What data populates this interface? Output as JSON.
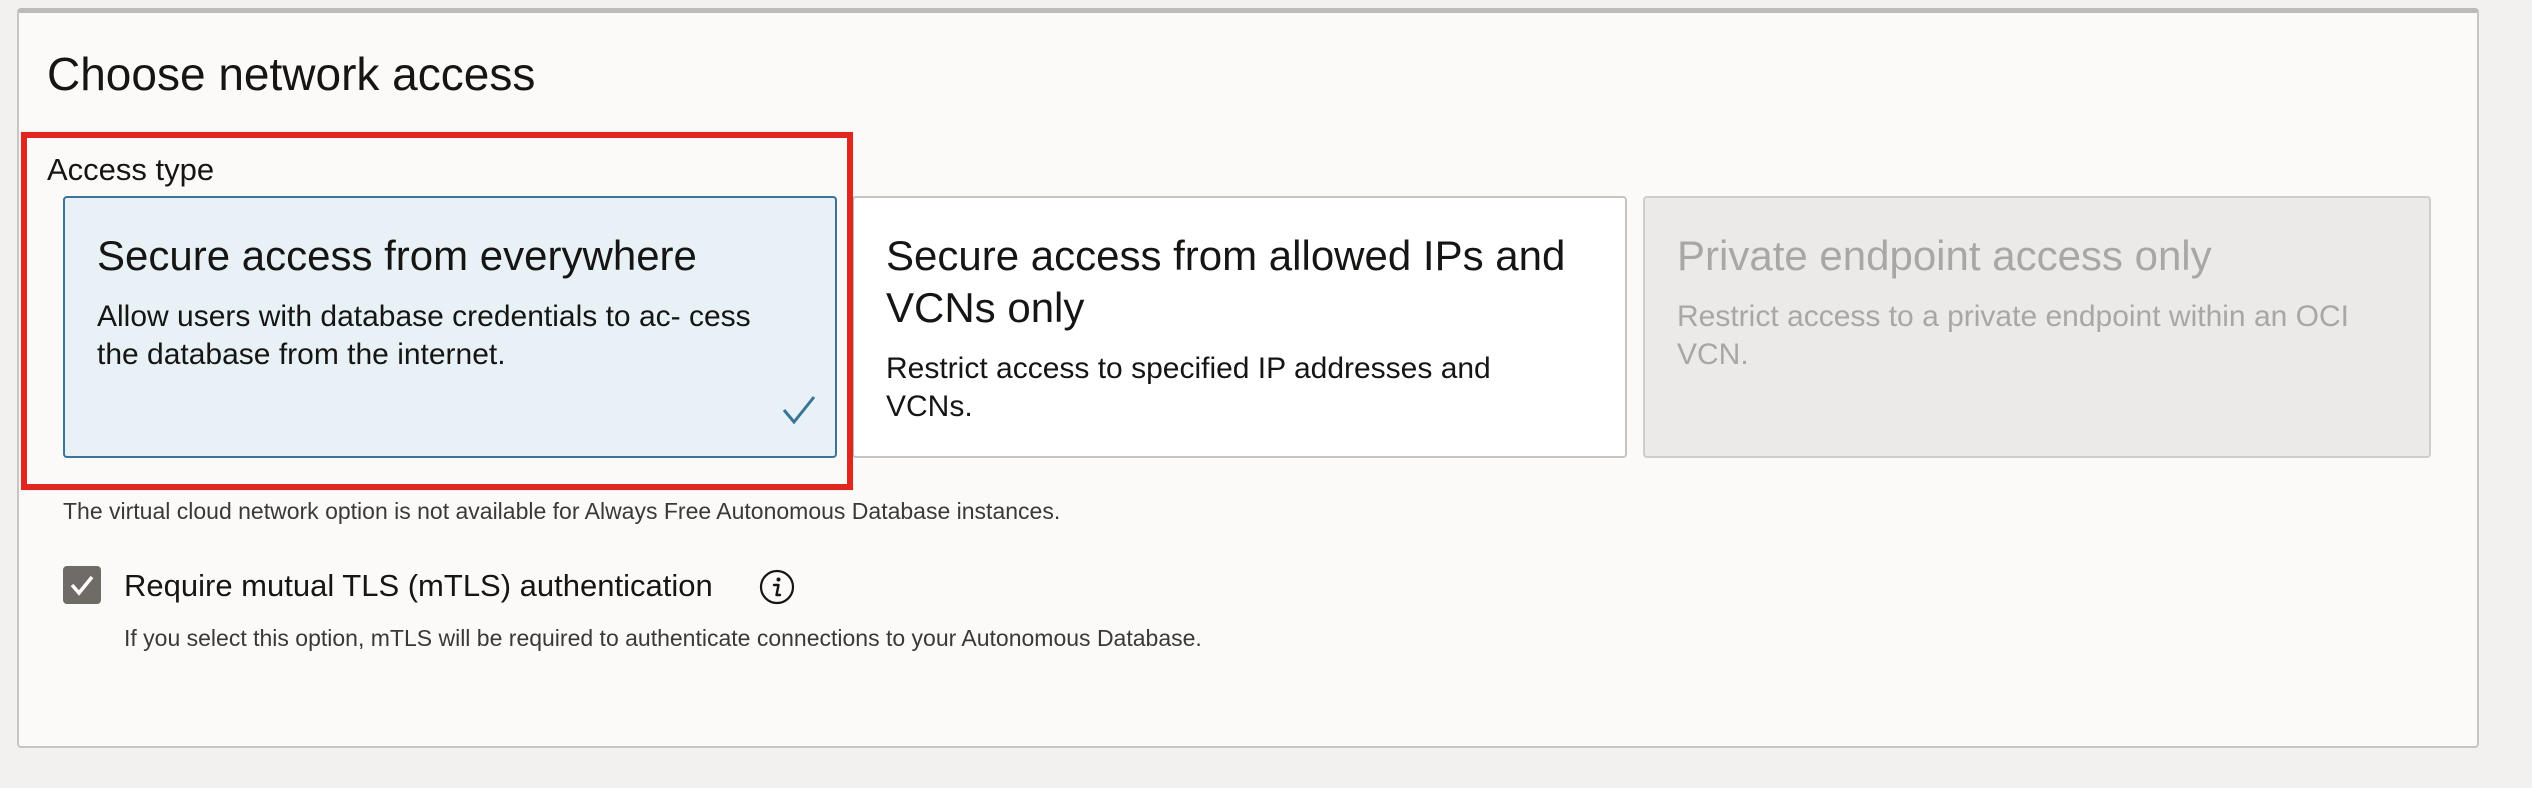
{
  "network_access": {
    "title": "Choose network access",
    "access_type_label": "Access type",
    "options": [
      {
        "title": "Secure access from everywhere",
        "description": "Allow users with database credentials to ac- cess the database from the internet.",
        "selected": true,
        "disabled": false
      },
      {
        "title": "Secure access from allowed IPs and VCNs only",
        "description": "Restrict access to specified IP addresses and VCNs.",
        "selected": false,
        "disabled": false
      },
      {
        "title": "Private endpoint access only",
        "description": "Restrict access to a private endpoint within an OCI VCN.",
        "selected": false,
        "disabled": true
      }
    ],
    "vcn_note": "The virtual cloud network option is not available for Always Free Autonomous Database instances.",
    "mtls": {
      "label": "Require mutual TLS (mTLS) authentication",
      "checked": true,
      "help_text": "If you select this option, mTLS will be required to authenticate connections to your Autonomous Database."
    }
  },
  "icons": {
    "selected_check": "check-icon",
    "checkbox_check": "checkmark-icon",
    "info": "info-icon"
  },
  "colors": {
    "highlight_border": "#e0261e",
    "selected_card_bg": "#e7f1f6",
    "selected_card_border": "#3a7496",
    "check_color": "#3a7496",
    "checkbox_bg": "#6f6c68",
    "disabled_text": "#a9a7a4"
  }
}
